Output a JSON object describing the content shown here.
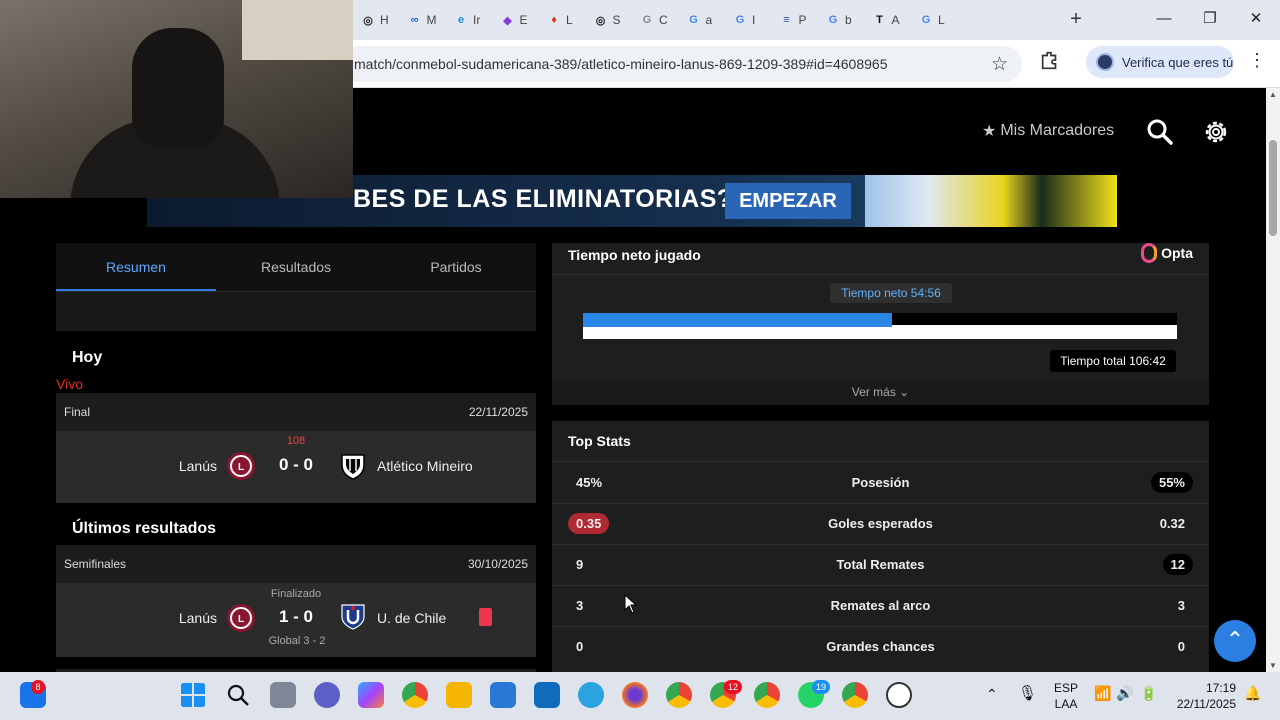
{
  "browser": {
    "tabs": [
      {
        "letter": "H",
        "color": "#222222",
        "glyph": "◎"
      },
      {
        "letter": "M",
        "color": "#1a6bd8",
        "glyph": "∞"
      },
      {
        "letter": "Ir",
        "color": "#1c8ad6",
        "glyph": "e"
      },
      {
        "letter": "E",
        "color": "#8a3bd6",
        "glyph": "◆"
      },
      {
        "letter": "L",
        "color": "#d83a1a",
        "glyph": "♦"
      },
      {
        "letter": "S",
        "color": "#222222",
        "glyph": "◎"
      },
      {
        "letter": "C",
        "color": "#888888",
        "glyph": "G"
      },
      {
        "letter": "a",
        "color": "#4285f4",
        "glyph": "G"
      },
      {
        "letter": "I",
        "color": "#4285f4",
        "glyph": "G"
      },
      {
        "letter": "P",
        "color": "#2b4ea8",
        "glyph": "≡"
      },
      {
        "letter": "b",
        "color": "#4285f4",
        "glyph": "G"
      },
      {
        "letter": "A",
        "color": "#111111",
        "glyph": "T"
      },
      {
        "letter": "L",
        "color": "#4285f4",
        "glyph": "G"
      }
    ],
    "new_tab": "+",
    "url": "match/conmebol-sudamericana-389/atletico-mineiro-lanus-869-1209-389#id=4608965",
    "verify_label": "Verifica que eres tú",
    "minimize": "—",
    "maximize": "❐",
    "close": "✕"
  },
  "header": {
    "mis_marcadores": "Mis Marcadores",
    "star": "★"
  },
  "banner": {
    "text": "BES DE LAS ELIMINATORIAS?",
    "cta": "EMPEZAR"
  },
  "left": {
    "tabs": [
      "Resumen",
      "Resultados",
      "Partidos"
    ],
    "hoy_title": "Hoy",
    "vivo": "Vivo",
    "today_match": {
      "stage": "Final",
      "date": "22/11/2025",
      "minute": "108",
      "home": "Lanús",
      "score": "0 - 0",
      "away": "Atlético Mineiro"
    },
    "ultimos_title": "Últimos resultados",
    "last_match": {
      "stage": "Semifinales",
      "date": "30/10/2025",
      "status": "Finalizado",
      "home": "Lanús",
      "score": "1 - 0",
      "away": "U. de Chile",
      "global": "Global 3 - 2"
    }
  },
  "net_time": {
    "title": "Tiempo neto jugado",
    "provider": "Opta",
    "net_label": "Tiempo neto 54:56",
    "total_label": "Tiempo total 106:42",
    "fraction": 0.52,
    "ver_mas": "Ver más ⌄"
  },
  "top_stats": {
    "title": "Top Stats",
    "rows": [
      {
        "left": "45%",
        "label": "Posesión",
        "right": "55%",
        "highlight": "right",
        "hl_color": "dark"
      },
      {
        "left": "0.35",
        "label": "Goles esperados",
        "right": "0.32",
        "highlight": "left",
        "hl_color": "red"
      },
      {
        "left": "9",
        "label": "Total Remates",
        "right": "12",
        "highlight": "right",
        "hl_color": "dark"
      },
      {
        "left": "3",
        "label": "Remates al arco",
        "right": "3",
        "highlight": "none",
        "hl_color": ""
      },
      {
        "left": "0",
        "label": "Grandes chances",
        "right": "0",
        "highlight": "none",
        "hl_color": ""
      }
    ]
  },
  "scroll_top": "⌃",
  "taskbar": {
    "badge_left": "8",
    "badge_chrome": "12",
    "badge_whatsapp": "19",
    "lang_line1": "ESP",
    "lang_line2": "LAA",
    "time": "17:19",
    "date": "22/11/2025"
  }
}
